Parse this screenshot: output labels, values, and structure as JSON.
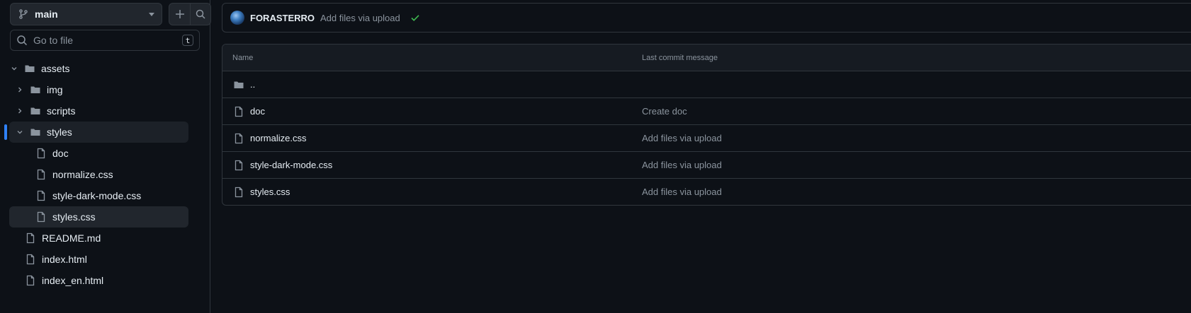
{
  "branch": {
    "name": "main",
    "icon": "git-branch-icon"
  },
  "actions": {
    "add_icon": "plus-icon",
    "search_icon": "search-icon"
  },
  "goto_file": {
    "placeholder": "Go to file",
    "shortcut": "t"
  },
  "tree": [
    {
      "label": "assets",
      "type": "folder",
      "expanded": true
    },
    {
      "label": "img",
      "type": "folder",
      "expanded": false
    },
    {
      "label": "scripts",
      "type": "folder",
      "expanded": false
    },
    {
      "label": "styles",
      "type": "folder",
      "expanded": true
    },
    {
      "label": "doc",
      "type": "file"
    },
    {
      "label": "normalize.css",
      "type": "file"
    },
    {
      "label": "style-dark-mode.css",
      "type": "file"
    },
    {
      "label": "styles.css",
      "type": "file",
      "active": true
    },
    {
      "label": "README.md",
      "type": "file"
    },
    {
      "label": "index.html",
      "type": "file"
    },
    {
      "label": "index_en.html",
      "type": "file"
    }
  ],
  "latest_commit": {
    "author": "FORASTERRO",
    "message": "Add files via upload",
    "status": "success"
  },
  "table": {
    "headers": {
      "name": "Name",
      "message": "Last commit message"
    },
    "rows": [
      {
        "name": "..",
        "type": "folder",
        "message": ""
      },
      {
        "name": "doc",
        "type": "file",
        "message": "Create doc"
      },
      {
        "name": "normalize.css",
        "type": "file",
        "message": "Add files via upload"
      },
      {
        "name": "style-dark-mode.css",
        "type": "file",
        "message": "Add files via upload"
      },
      {
        "name": "styles.css",
        "type": "file",
        "message": "Add files via upload"
      }
    ]
  },
  "colors": {
    "accent": "#2f81f7",
    "success": "#3fb950",
    "bg": "#0d1117",
    "border": "#30363d"
  }
}
